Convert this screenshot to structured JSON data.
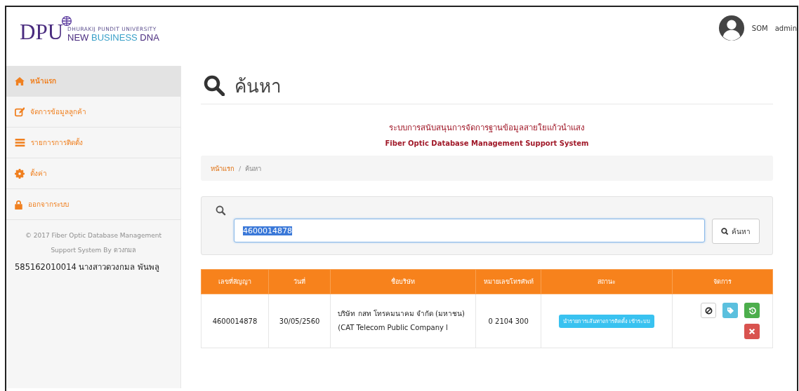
{
  "logo": {
    "mark": "DPU",
    "university": "DHURAKIJ PUNDIT UNIVERSITY",
    "tagline": [
      {
        "text": "NEW",
        "kind": "dark"
      },
      {
        "text": "BUSINESS",
        "kind": "accent"
      },
      {
        "text": "DNA",
        "kind": "dark"
      }
    ]
  },
  "user": {
    "name": "SOM",
    "role": "admin"
  },
  "sidebar": {
    "items": [
      {
        "label": "หน้าแรก",
        "kind": "home",
        "selected": true
      },
      {
        "label": "จัดการข้อมูลลูกค้า",
        "kind": "edit",
        "selected": false
      },
      {
        "label": "รายการการติดตั้ง",
        "kind": "list",
        "selected": false
      },
      {
        "label": "ตั้งค่า",
        "kind": "gear",
        "selected": false
      },
      {
        "label": "ออกจากระบบ",
        "kind": "lock",
        "selected": false
      }
    ],
    "footer": "© 2017 Fiber Optic Database Management Support System By ดวงกมล",
    "student": "585162010014 นางสาวดวงกมล พันพลู"
  },
  "page": {
    "title": "ค้นหา",
    "system_th": "ระบบการสนับสนุนการจัดการฐานข้อมูลสายใยแก้วนำแสง",
    "system_en": "Fiber Optic Database Management Support System",
    "breadcrumb": [
      "หน้าแรก",
      "ค้นหา"
    ],
    "breadcrumb_separator": "/"
  },
  "search": {
    "value": "4600014878",
    "button": "ค้นหา"
  },
  "table": {
    "columns": [
      "เลขที่สัญญา",
      "วันที่",
      "ชื่อบริษัท",
      "หมายเลขโทรศัพท์",
      "สถานะ",
      "จัดการ"
    ],
    "rows": [
      {
        "contract": "4600014878",
        "date": "30/05/2560",
        "company": "บริษัท กสท โทรคมนาคม จำกัด (มหาชน) (CAT Telecom Public Company l",
        "phone": "0 2104 300",
        "status": "นำรายการเส้นทางการติดตั้ง เข้าระบบ",
        "actions": [
          {
            "kind": "ban"
          },
          {
            "kind": "tag"
          },
          {
            "kind": "undo"
          },
          {
            "kind": "delete"
          }
        ]
      }
    ]
  }
}
